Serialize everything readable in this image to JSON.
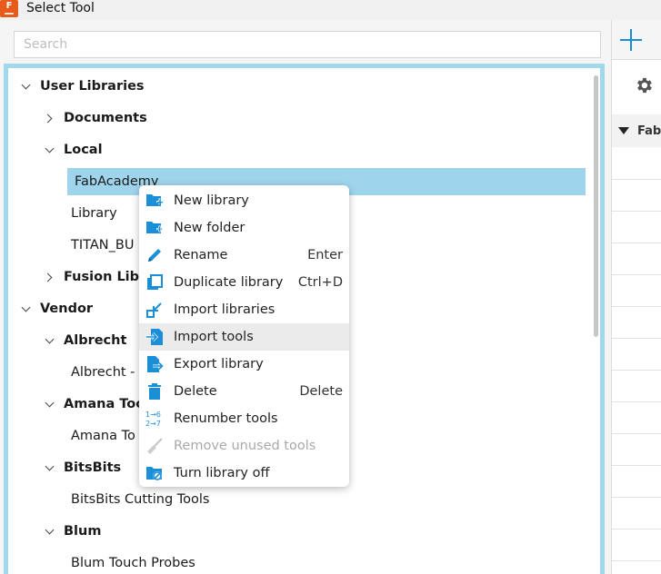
{
  "window": {
    "title": "Select Tool",
    "app_icon": "fusion-app-icon"
  },
  "search": {
    "placeholder": "Search"
  },
  "tree": {
    "items": [
      {
        "label": "User Libraries",
        "level": 0,
        "bold": true,
        "expand": "down"
      },
      {
        "label": "Documents",
        "level": 1,
        "bold": true,
        "expand": "right"
      },
      {
        "label": "Local",
        "level": 1,
        "bold": true,
        "expand": "down"
      },
      {
        "label": "FabAcademy",
        "level": 2,
        "bold": false,
        "expand": "none",
        "selected": true
      },
      {
        "label": "Library",
        "level": 2,
        "bold": false,
        "expand": "none"
      },
      {
        "label": "TITAN_BU",
        "level": 2,
        "bold": false,
        "expand": "none"
      },
      {
        "label": "Fusion Libra",
        "level": 1,
        "bold": true,
        "expand": "right"
      },
      {
        "label": "Vendor",
        "level": 0,
        "bold": true,
        "expand": "down"
      },
      {
        "label": "Albrecht",
        "level": 1,
        "bold": true,
        "expand": "down"
      },
      {
        "label": "Albrecht -",
        "level": 2,
        "bold": false,
        "expand": "none"
      },
      {
        "label": "Amana Tool",
        "level": 1,
        "bold": true,
        "expand": "down"
      },
      {
        "label": "Amana To",
        "level": 2,
        "bold": false,
        "expand": "none"
      },
      {
        "label": "BitsBits",
        "level": 1,
        "bold": true,
        "expand": "down"
      },
      {
        "label": "BitsBits Cutting Tools",
        "level": 2,
        "bold": false,
        "expand": "none"
      },
      {
        "label": "Blum",
        "level": 1,
        "bold": true,
        "expand": "down"
      },
      {
        "label": "Blum Touch Probes",
        "level": 2,
        "bold": false,
        "expand": "none"
      }
    ]
  },
  "right_panel": {
    "header_label": "Fab",
    "add_icon": "plus-icon",
    "settings_icon": "gear-icon"
  },
  "context_menu": {
    "items": [
      {
        "label": "New library",
        "shortcut": "",
        "icon": "new-library-icon"
      },
      {
        "label": "New folder",
        "shortcut": "",
        "icon": "new-folder-icon"
      },
      {
        "label": "Rename",
        "shortcut": "Enter",
        "icon": "rename-icon"
      },
      {
        "label": "Duplicate library",
        "shortcut": "Ctrl+D",
        "icon": "duplicate-icon"
      },
      {
        "label": "Import libraries",
        "shortcut": "",
        "icon": "import-libraries-icon"
      },
      {
        "label": "Import tools",
        "shortcut": "",
        "icon": "import-tools-icon",
        "hover": true
      },
      {
        "label": "Export library",
        "shortcut": "",
        "icon": "export-library-icon"
      },
      {
        "label": "Delete",
        "shortcut": "Delete",
        "icon": "delete-icon"
      },
      {
        "label": "Renumber tools",
        "shortcut": "",
        "icon": "renumber-icon"
      },
      {
        "label": "Remove unused tools",
        "shortcut": "",
        "icon": "remove-unused-icon",
        "disabled": true
      },
      {
        "label": "Turn library off",
        "shortcut": "",
        "icon": "library-off-icon"
      }
    ]
  },
  "colors": {
    "accent": "#1a8fd8",
    "selection": "#9fd5ec",
    "frame": "#a2d8ee"
  }
}
